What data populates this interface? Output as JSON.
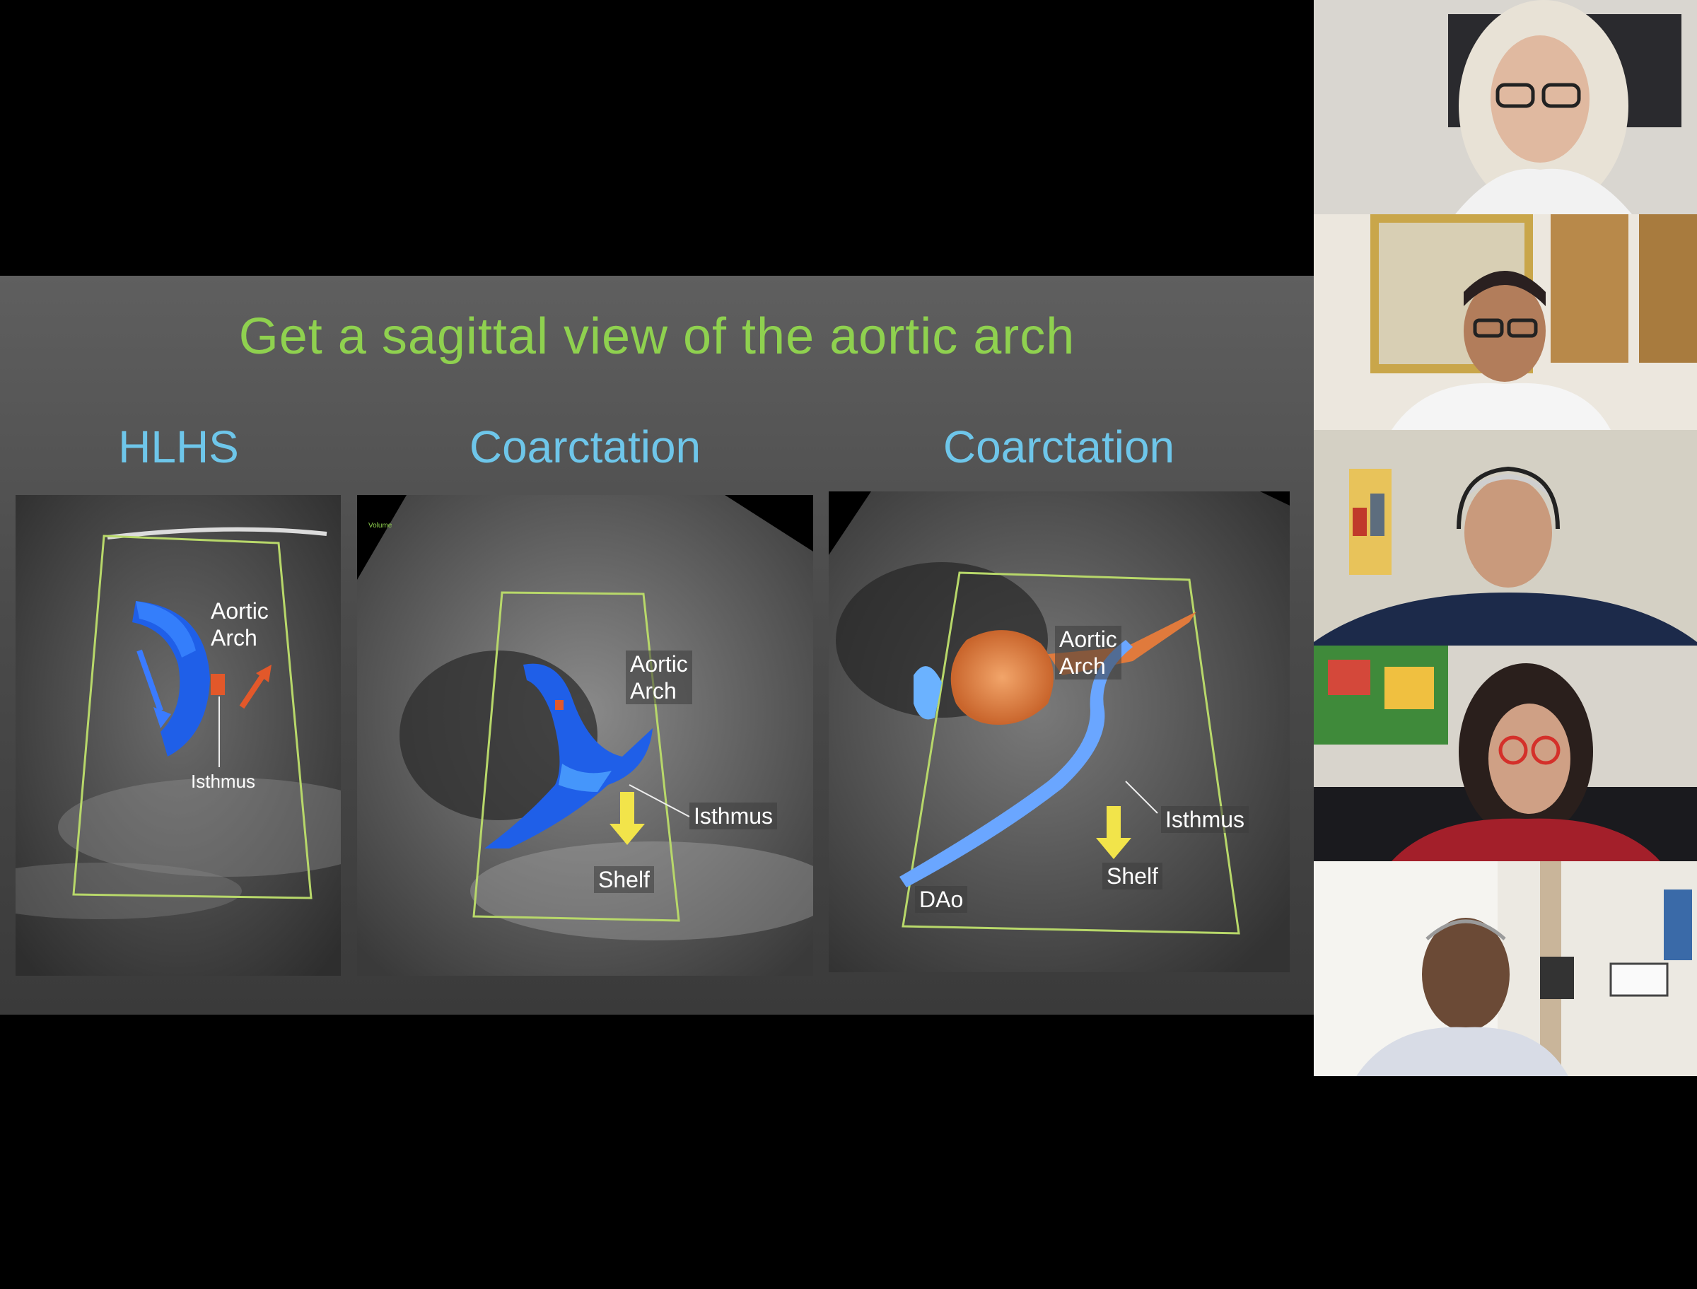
{
  "slide": {
    "title": "Get a sagittal view of the aortic arch",
    "panels": [
      {
        "heading": "HLHS",
        "labels": {
          "arch": "Aortic\nArch",
          "isthmus": "Isthmus"
        }
      },
      {
        "heading": "Coarctation",
        "labels": {
          "arch": "Aortic\nArch",
          "isthmus": "Isthmus",
          "shelf": "Shelf"
        }
      },
      {
        "heading": "Coarctation",
        "labels": {
          "arch": "Aortic\nArch",
          "isthmus": "Isthmus",
          "shelf": "Shelf",
          "dao": "DAo"
        }
      }
    ]
  },
  "colors": {
    "title_green": "#8fd14f",
    "heading_blue": "#6ec6ea",
    "doppler_blue": "#1f5fe8",
    "doppler_red": "#e2582a",
    "arrow_yellow": "#f2e44a",
    "sector_outline": "#b8d86a"
  },
  "participants": [
    {
      "icon": "participant-video-woman-glasses"
    },
    {
      "icon": "participant-video-man-glasses"
    },
    {
      "icon": "participant-video-man-headset"
    },
    {
      "icon": "participant-video-woman-red-glasses"
    },
    {
      "icon": "participant-video-man"
    }
  ]
}
